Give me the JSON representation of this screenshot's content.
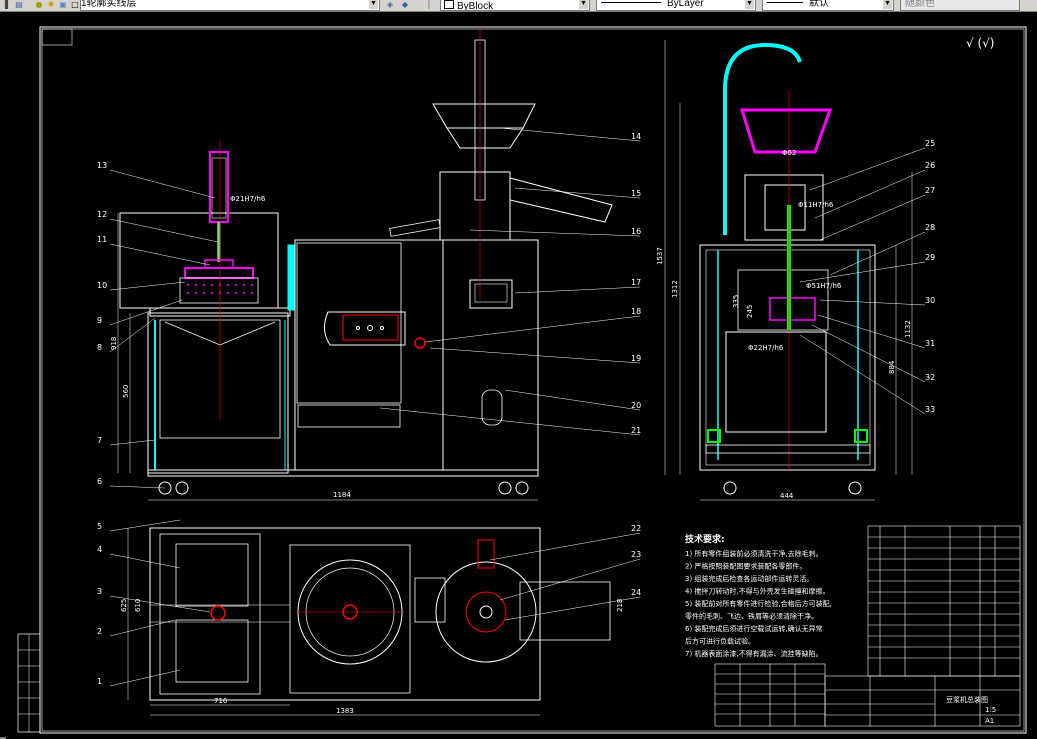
{
  "toolbar": {
    "layer_name": "1轮廓实线层",
    "color_combo": "ByBlock",
    "linetype_combo": "ByLayer",
    "lineweight_combo": "默认",
    "plotstyle_combo": "随颜色"
  },
  "drawing": {
    "roughness_symbol": "√ (√)",
    "front_dims": {
      "height_overall": "918",
      "lower": "560",
      "width": "1184"
    },
    "side_dims": {
      "overall": "1537",
      "mid": "1312",
      "right1": "1132",
      "right2": "884",
      "d1": "335",
      "d2": "245",
      "width": "444"
    },
    "plan_dims": {
      "left_w": "716",
      "total_w": "1383",
      "h1": "625",
      "h2": "610",
      "right_h": "218"
    },
    "fits": {
      "front_fit": "Φ21H7/h6",
      "side_fit1": "Φ62",
      "side_fit2": "Φ11H7/h6",
      "side_fit3": "Φ51H7/h6",
      "side_fit4": "Φ22H7/h6"
    },
    "callouts_left": [
      "13",
      "12",
      "11",
      "10",
      "9",
      "8",
      "7",
      "6",
      "5",
      "4",
      "3",
      "2",
      "1"
    ],
    "callouts_mid": [
      "14",
      "15",
      "16",
      "17",
      "18",
      "19",
      "20",
      "21",
      "22",
      "23",
      "24"
    ],
    "callouts_right": [
      "25",
      "26",
      "27",
      "28",
      "29",
      "30",
      "31",
      "32",
      "33"
    ],
    "notes_title": "技术要求:",
    "notes": [
      "1) 所有零件组装前必须清洗干净,去除毛刺。",
      "2) 严格按照装配图要求装配各零部件。",
      "3) 组装完成后检查各运动部件运转灵活。",
      "4) 搅拌刀转动时,不得与外壳发生碰撞和摩擦。",
      "5) 装配前对所有零件进行检验,合格后方可装配,",
      "   零件的毛刺、飞边、铁屑等必须清除干净。",
      "6) 装配完成后须进行空载试运转,确认无异常",
      "   后方可进行负载试验。",
      "7) 机器表面涂漆,不得有漏涂、流挂等缺陷。"
    ],
    "title_block": {
      "name": "豆浆机总装图",
      "scale": "1:5",
      "sheet": "A1"
    }
  }
}
